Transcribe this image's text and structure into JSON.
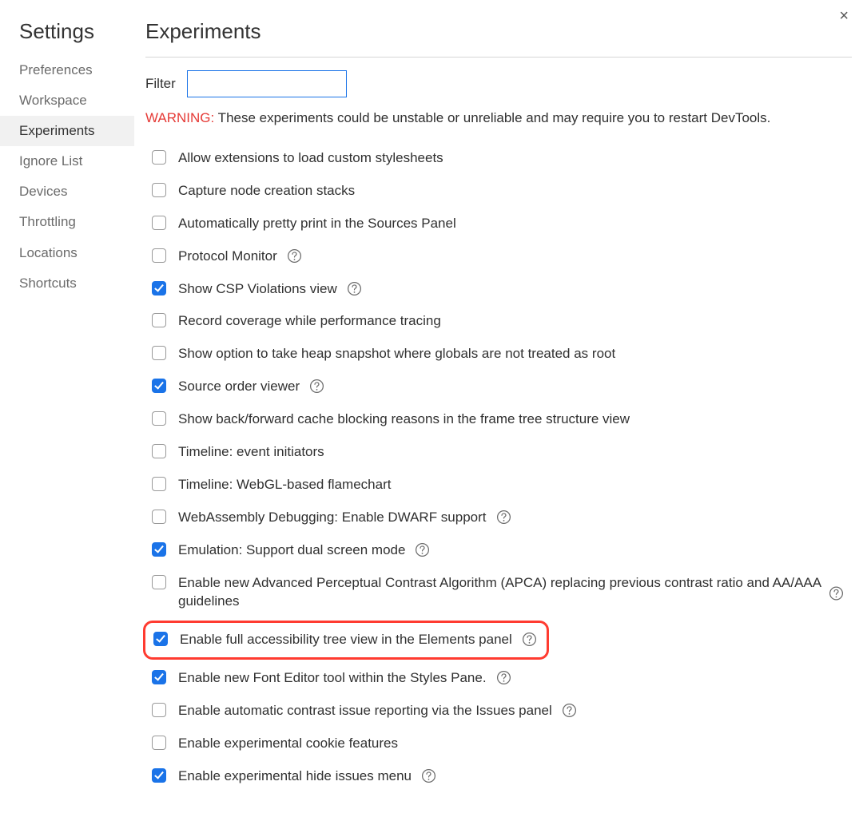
{
  "close_label": "×",
  "sidebar": {
    "title": "Settings",
    "items": [
      {
        "label": "Preferences",
        "active": false
      },
      {
        "label": "Workspace",
        "active": false
      },
      {
        "label": "Experiments",
        "active": true
      },
      {
        "label": "Ignore List",
        "active": false
      },
      {
        "label": "Devices",
        "active": false
      },
      {
        "label": "Throttling",
        "active": false
      },
      {
        "label": "Locations",
        "active": false
      },
      {
        "label": "Shortcuts",
        "active": false
      }
    ]
  },
  "main": {
    "title": "Experiments",
    "filter_label": "Filter",
    "filter_value": "",
    "warning_label": "WARNING:",
    "warning_text": " These experiments could be unstable or unreliable and may require you to restart DevTools.",
    "experiments": [
      {
        "label": "Allow extensions to load custom stylesheets",
        "checked": false,
        "help": false,
        "highlight": false,
        "trailing_help": false
      },
      {
        "label": "Capture node creation stacks",
        "checked": false,
        "help": false,
        "highlight": false,
        "trailing_help": false
      },
      {
        "label": "Automatically pretty print in the Sources Panel",
        "checked": false,
        "help": false,
        "highlight": false,
        "trailing_help": false
      },
      {
        "label": "Protocol Monitor",
        "checked": false,
        "help": true,
        "highlight": false,
        "trailing_help": false
      },
      {
        "label": "Show CSP Violations view",
        "checked": true,
        "help": true,
        "highlight": false,
        "trailing_help": false
      },
      {
        "label": "Record coverage while performance tracing",
        "checked": false,
        "help": false,
        "highlight": false,
        "trailing_help": false
      },
      {
        "label": "Show option to take heap snapshot where globals are not treated as root",
        "checked": false,
        "help": false,
        "highlight": false,
        "trailing_help": false
      },
      {
        "label": "Source order viewer",
        "checked": true,
        "help": true,
        "highlight": false,
        "trailing_help": false
      },
      {
        "label": "Show back/forward cache blocking reasons in the frame tree structure view",
        "checked": false,
        "help": false,
        "highlight": false,
        "trailing_help": false
      },
      {
        "label": "Timeline: event initiators",
        "checked": false,
        "help": false,
        "highlight": false,
        "trailing_help": false
      },
      {
        "label": "Timeline: WebGL-based flamechart",
        "checked": false,
        "help": false,
        "highlight": false,
        "trailing_help": false
      },
      {
        "label": "WebAssembly Debugging: Enable DWARF support",
        "checked": false,
        "help": true,
        "highlight": false,
        "trailing_help": false
      },
      {
        "label": "Emulation: Support dual screen mode",
        "checked": true,
        "help": true,
        "highlight": false,
        "trailing_help": false
      },
      {
        "label": "Enable new Advanced Perceptual Contrast Algorithm (APCA) replacing previous contrast ratio and AA/AAA guidelines",
        "checked": false,
        "help": false,
        "highlight": false,
        "trailing_help": true
      },
      {
        "label": "Enable full accessibility tree view in the Elements panel",
        "checked": true,
        "help": true,
        "highlight": true,
        "trailing_help": false
      },
      {
        "label": "Enable new Font Editor tool within the Styles Pane.",
        "checked": true,
        "help": true,
        "highlight": false,
        "trailing_help": false
      },
      {
        "label": "Enable automatic contrast issue reporting via the Issues panel",
        "checked": false,
        "help": true,
        "highlight": false,
        "trailing_help": false
      },
      {
        "label": "Enable experimental cookie features",
        "checked": false,
        "help": false,
        "highlight": false,
        "trailing_help": false
      },
      {
        "label": "Enable experimental hide issues menu",
        "checked": true,
        "help": true,
        "highlight": false,
        "trailing_help": false
      }
    ]
  }
}
